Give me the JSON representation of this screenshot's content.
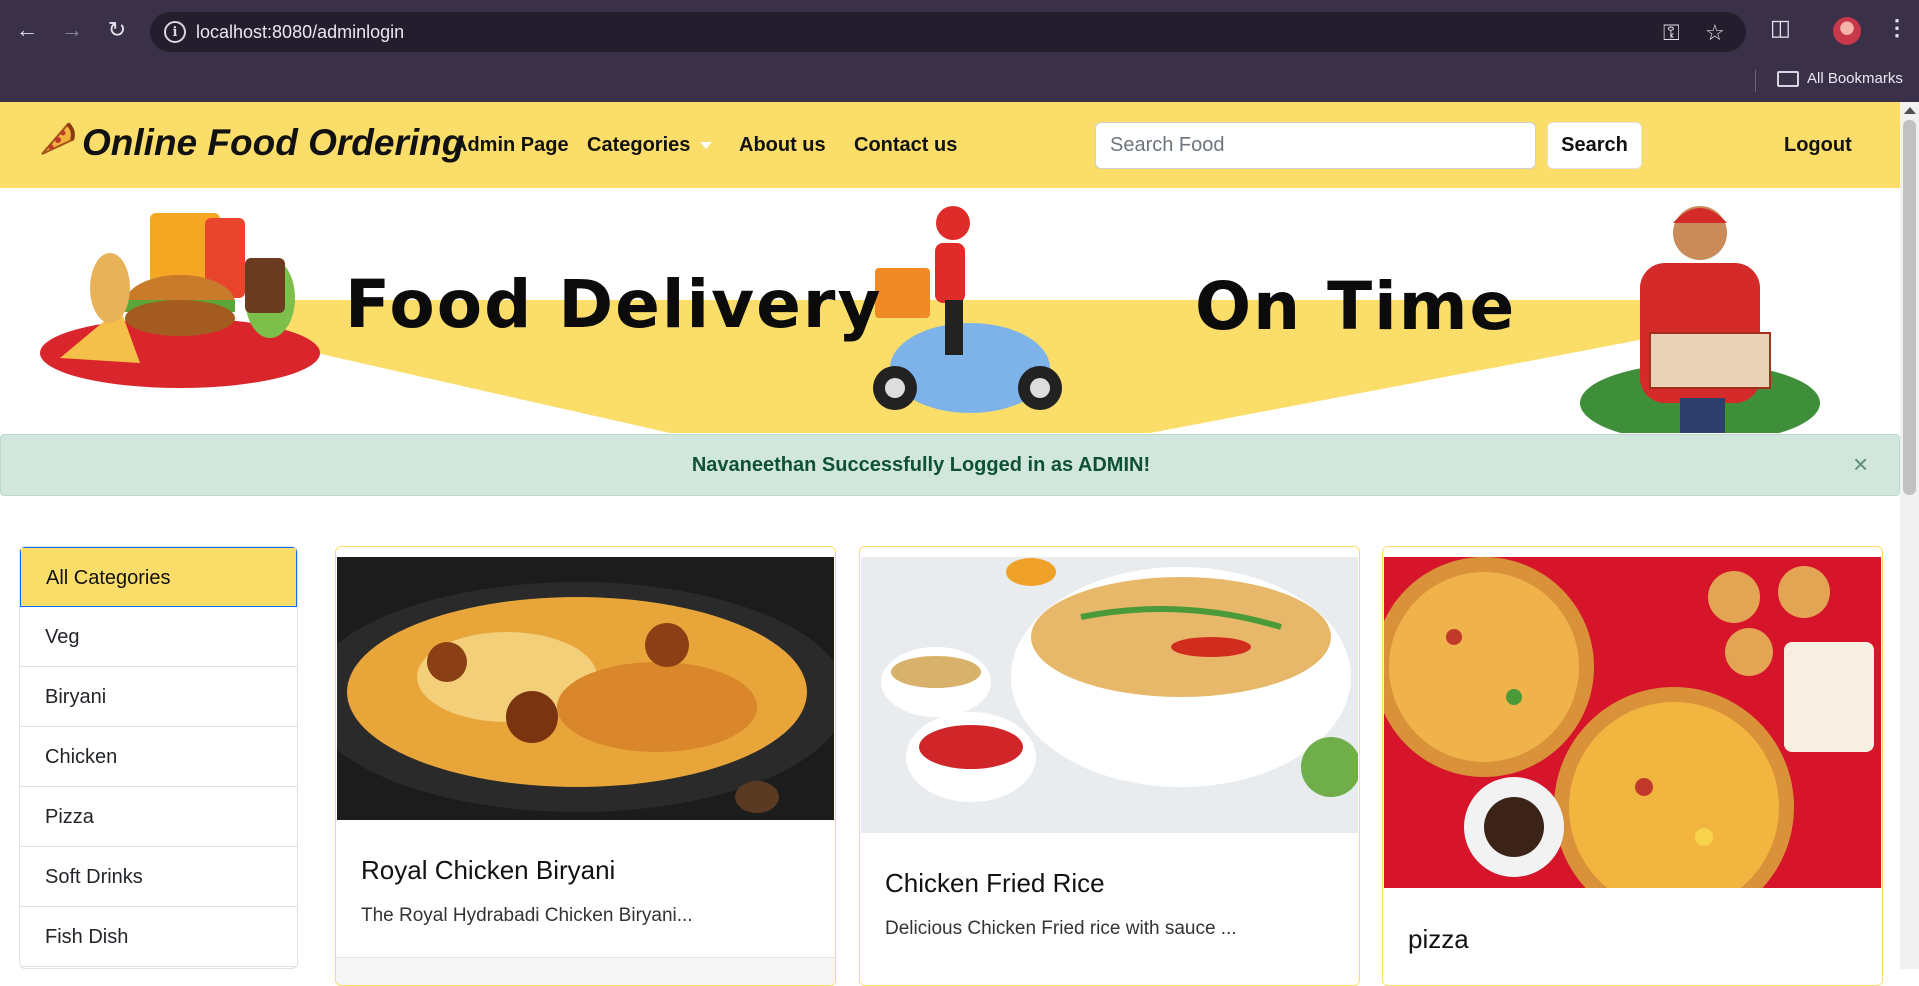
{
  "browser": {
    "url": "localhost:8080/adminlogin",
    "bookmarks_label": "All Bookmarks"
  },
  "navbar": {
    "brand": "Online Food Ordering",
    "links": [
      "Admin Page",
      "Categories",
      "About us",
      "Contact us"
    ],
    "search_placeholder": "Search Food",
    "search_button": "Search",
    "logout": "Logout",
    "accent_color": "#fbdd6a"
  },
  "banner": {
    "left_text": "Food Delivery",
    "right_text": "On Time"
  },
  "alert": {
    "message": "Navaneethan Successfully Logged in as ADMIN!",
    "close_symbol": "×",
    "color": "#d1e7dd"
  },
  "categories": {
    "items": [
      "All Categories",
      "Veg",
      "Biryani",
      "Chicken",
      "Pizza",
      "Soft Drinks",
      "Fish Dish"
    ],
    "active": "All Categories"
  },
  "cards": [
    {
      "title": "Royal Chicken Biryani",
      "description": "The Royal Hydrabadi Chicken Biryani..."
    },
    {
      "title": "Chicken Fried Rice",
      "description": "Delicious Chicken Fried rice with sauce ..."
    },
    {
      "title": "pizza",
      "description": ""
    }
  ]
}
